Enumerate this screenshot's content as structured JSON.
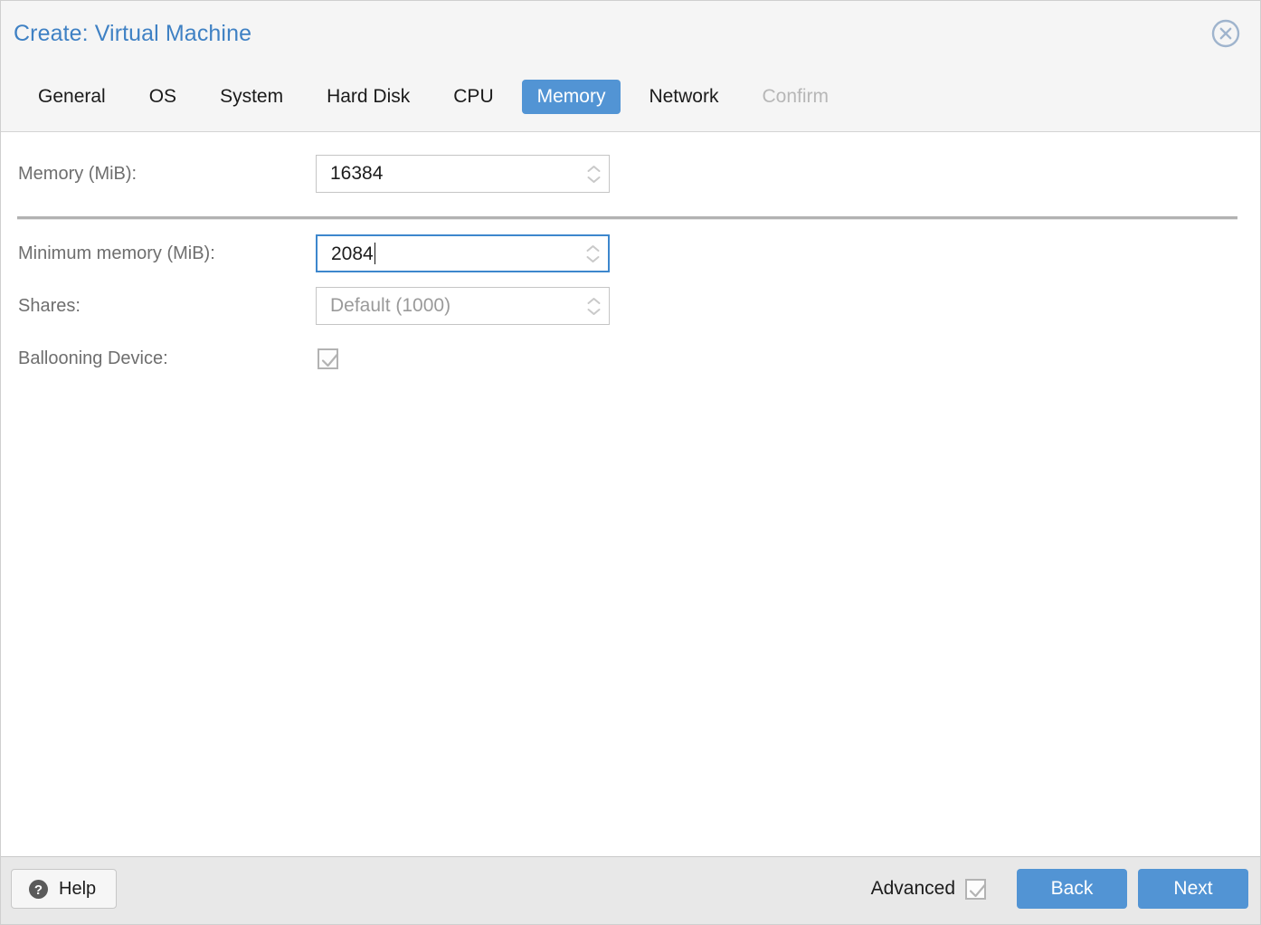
{
  "dialog": {
    "title": "Create: Virtual Machine",
    "close_icon": "close-circle-icon",
    "accent_color": "#5294d4",
    "title_color": "#3f81c4"
  },
  "tabs": [
    {
      "label": "General",
      "state": "normal"
    },
    {
      "label": "OS",
      "state": "normal"
    },
    {
      "label": "System",
      "state": "normal"
    },
    {
      "label": "Hard Disk",
      "state": "normal"
    },
    {
      "label": "CPU",
      "state": "normal"
    },
    {
      "label": "Memory",
      "state": "active"
    },
    {
      "label": "Network",
      "state": "normal"
    },
    {
      "label": "Confirm",
      "state": "disabled"
    }
  ],
  "form": {
    "memory": {
      "label": "Memory (MiB):",
      "value": "16384",
      "placeholder": "",
      "focused": false
    },
    "minimum_memory": {
      "label": "Minimum memory (MiB):",
      "value": "2084",
      "placeholder": "",
      "focused": true
    },
    "shares": {
      "label": "Shares:",
      "value": "",
      "placeholder": "Default (1000)",
      "focused": false
    },
    "ballooning": {
      "label": "Ballooning Device:",
      "checked": true
    }
  },
  "footer": {
    "help_label": "Help",
    "help_icon": "question-circle-icon",
    "advanced_label": "Advanced",
    "advanced_checked": true,
    "back_label": "Back",
    "next_label": "Next"
  }
}
